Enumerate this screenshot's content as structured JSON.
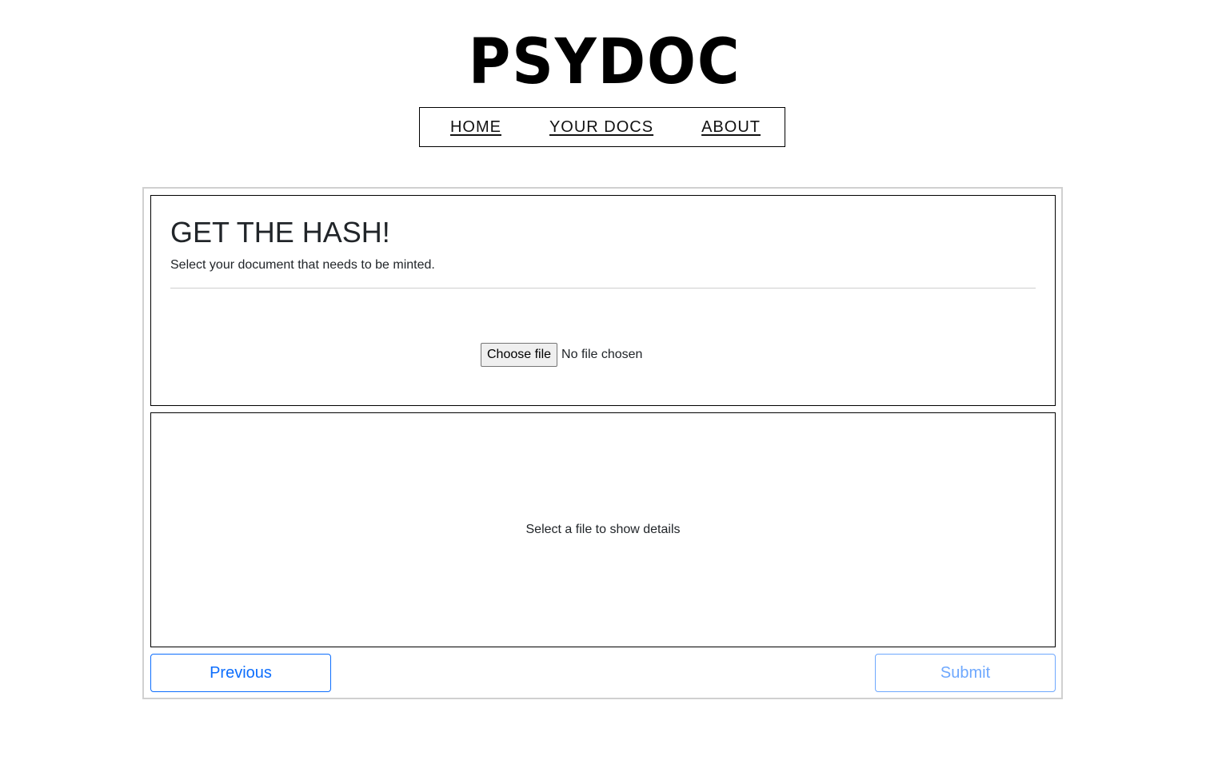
{
  "brand": {
    "logo_text": "PSYDOC"
  },
  "nav": {
    "items": [
      {
        "label": "HOME"
      },
      {
        "label": "YOUR DOCS"
      },
      {
        "label": "ABOUT"
      }
    ]
  },
  "upload": {
    "title": "GET THE HASH!",
    "subtitle": "Select your document that needs to be minted.",
    "choose_button_label": "Choose file",
    "file_status": "No file chosen"
  },
  "details": {
    "empty_message": "Select a file to show details"
  },
  "actions": {
    "previous_label": "Previous",
    "submit_label": "Submit"
  },
  "colors": {
    "primary": "#0d6efd",
    "primary_disabled": "#6ea8fe",
    "border_light": "#d0d0d0"
  }
}
